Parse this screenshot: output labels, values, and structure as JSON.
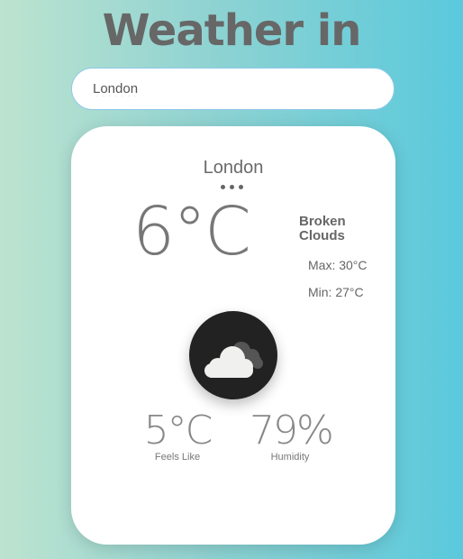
{
  "header": {
    "title": "Weather in"
  },
  "search": {
    "value": "London"
  },
  "weather": {
    "city": "London",
    "temperature": "6°C",
    "description": "Broken Clouds",
    "max": "Max: 30°C",
    "min": "Min: 27°C",
    "icon": "broken-clouds-icon",
    "feels_like": {
      "value": "5°C",
      "label": "Feels Like"
    },
    "humidity": {
      "value": "79%",
      "label": "Humidity"
    }
  }
}
